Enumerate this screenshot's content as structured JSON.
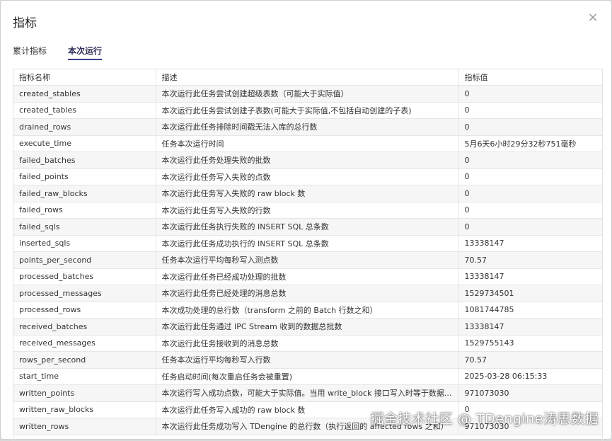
{
  "dialog": {
    "title": "指标",
    "close_icon": "×"
  },
  "tabs": [
    {
      "label": "累计指标",
      "active": false
    },
    {
      "label": "本次运行",
      "active": true
    }
  ],
  "table": {
    "headers": [
      "指标名称",
      "描述",
      "指标值"
    ],
    "rows": [
      [
        "created_stables",
        "本次运行此任务尝试创建超级表数（可能大于实际值）",
        "0"
      ],
      [
        "created_tables",
        "本次运行此任务尝试创建子表数(可能大于实际值,不包括自动创建的子表)",
        "0"
      ],
      [
        "drained_rows",
        "本次运行此任务排除时间戳无法入库的总行数",
        "0"
      ],
      [
        "execute_time",
        "任务本次运行时间",
        "5月6天6小时29分32秒751毫秒"
      ],
      [
        "failed_batches",
        "本次运行此任务处理失败的批数",
        "0"
      ],
      [
        "failed_points",
        "本次运行此任务写入失败的点数",
        "0"
      ],
      [
        "failed_raw_blocks",
        "本次运行此任务写入失败的 raw block 数",
        "0"
      ],
      [
        "failed_rows",
        "本次运行此任务写入失败的行数",
        "0"
      ],
      [
        "failed_sqls",
        "本次运行此任务执行失败的 INSERT SQL 总条数",
        "0"
      ],
      [
        "inserted_sqls",
        "本次运行此任务成功执行的 INSERT SQL 总条数",
        "13338147"
      ],
      [
        "points_per_second",
        "任务本次运行平均每秒写入测点数",
        "70.57"
      ],
      [
        "processed_batches",
        "本次运行此任务已经成功处理的批数",
        "13338147"
      ],
      [
        "processed_messages",
        "本次运行此任务已经处理的消息总数",
        "1529734501"
      ],
      [
        "processed_rows",
        "本次成功处理的总行数（transform 之前的 Batch 行数之和）",
        "1081744785"
      ],
      [
        "received_batches",
        "本次运行此任务通过 IPC Stream 收到的数据总批数",
        "13338147"
      ],
      [
        "received_messages",
        "本次运行此任务接收到的消息总数",
        "1529755143"
      ],
      [
        "rows_per_second",
        "任务本次运行平均每秒写入行数",
        "70.57"
      ],
      [
        "start_time",
        "任务启动时间(每次重启任务会被重置)",
        "2025-03-28 06:15:33"
      ],
      [
        "written_points",
        "本次运行写入成功点数，可能大于实际值。当用 write_block 接口写入时等于数据...",
        "971073030"
      ],
      [
        "written_raw_blocks",
        "本次运行此任务写入成功的 raw block 数",
        "0"
      ],
      [
        "written_rows",
        "本次运行此任务成功写入 TDengine 的总行数（执行返回的 affected rows 之和）",
        "971073030"
      ]
    ]
  },
  "watermark": "掘金技术社区 @ TDengine涛思数据"
}
